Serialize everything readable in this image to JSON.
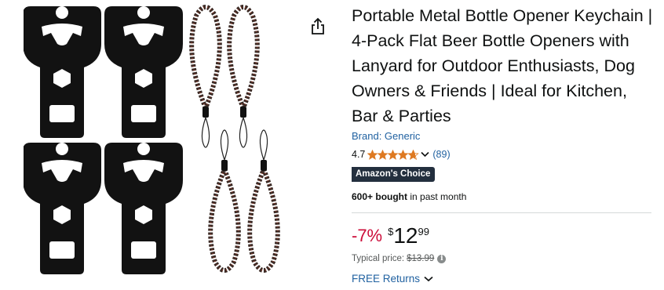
{
  "product": {
    "title": "Portable Metal Bottle Opener Keychain | 4-Pack Flat Beer Bottle Openers with Lanyard for Outdoor Enthusiasts, Dog Owners & Friends | Ideal for Kitchen, Bar & Parties",
    "brand": "Brand: Generic",
    "rating": "4.7",
    "rating_value": 4.7,
    "rating_count": "(89)",
    "badge": "Amazon's Choice",
    "bought_bold": "600+ bought",
    "bought_rest": " in past month",
    "discount": "-7%",
    "price_currency": "$",
    "price_whole": "12",
    "price_fraction": "99",
    "typical_label": "Typical price:",
    "typical_price": "$13.99",
    "returns": "FREE Returns"
  },
  "colors": {
    "star": "#de7921",
    "link": "#2162a1",
    "discount": "#cc0c39",
    "badge_bg": "#232f3e"
  },
  "icons": {
    "share": "share-icon",
    "info": "info-icon",
    "chevron": "chevron-down-icon"
  }
}
